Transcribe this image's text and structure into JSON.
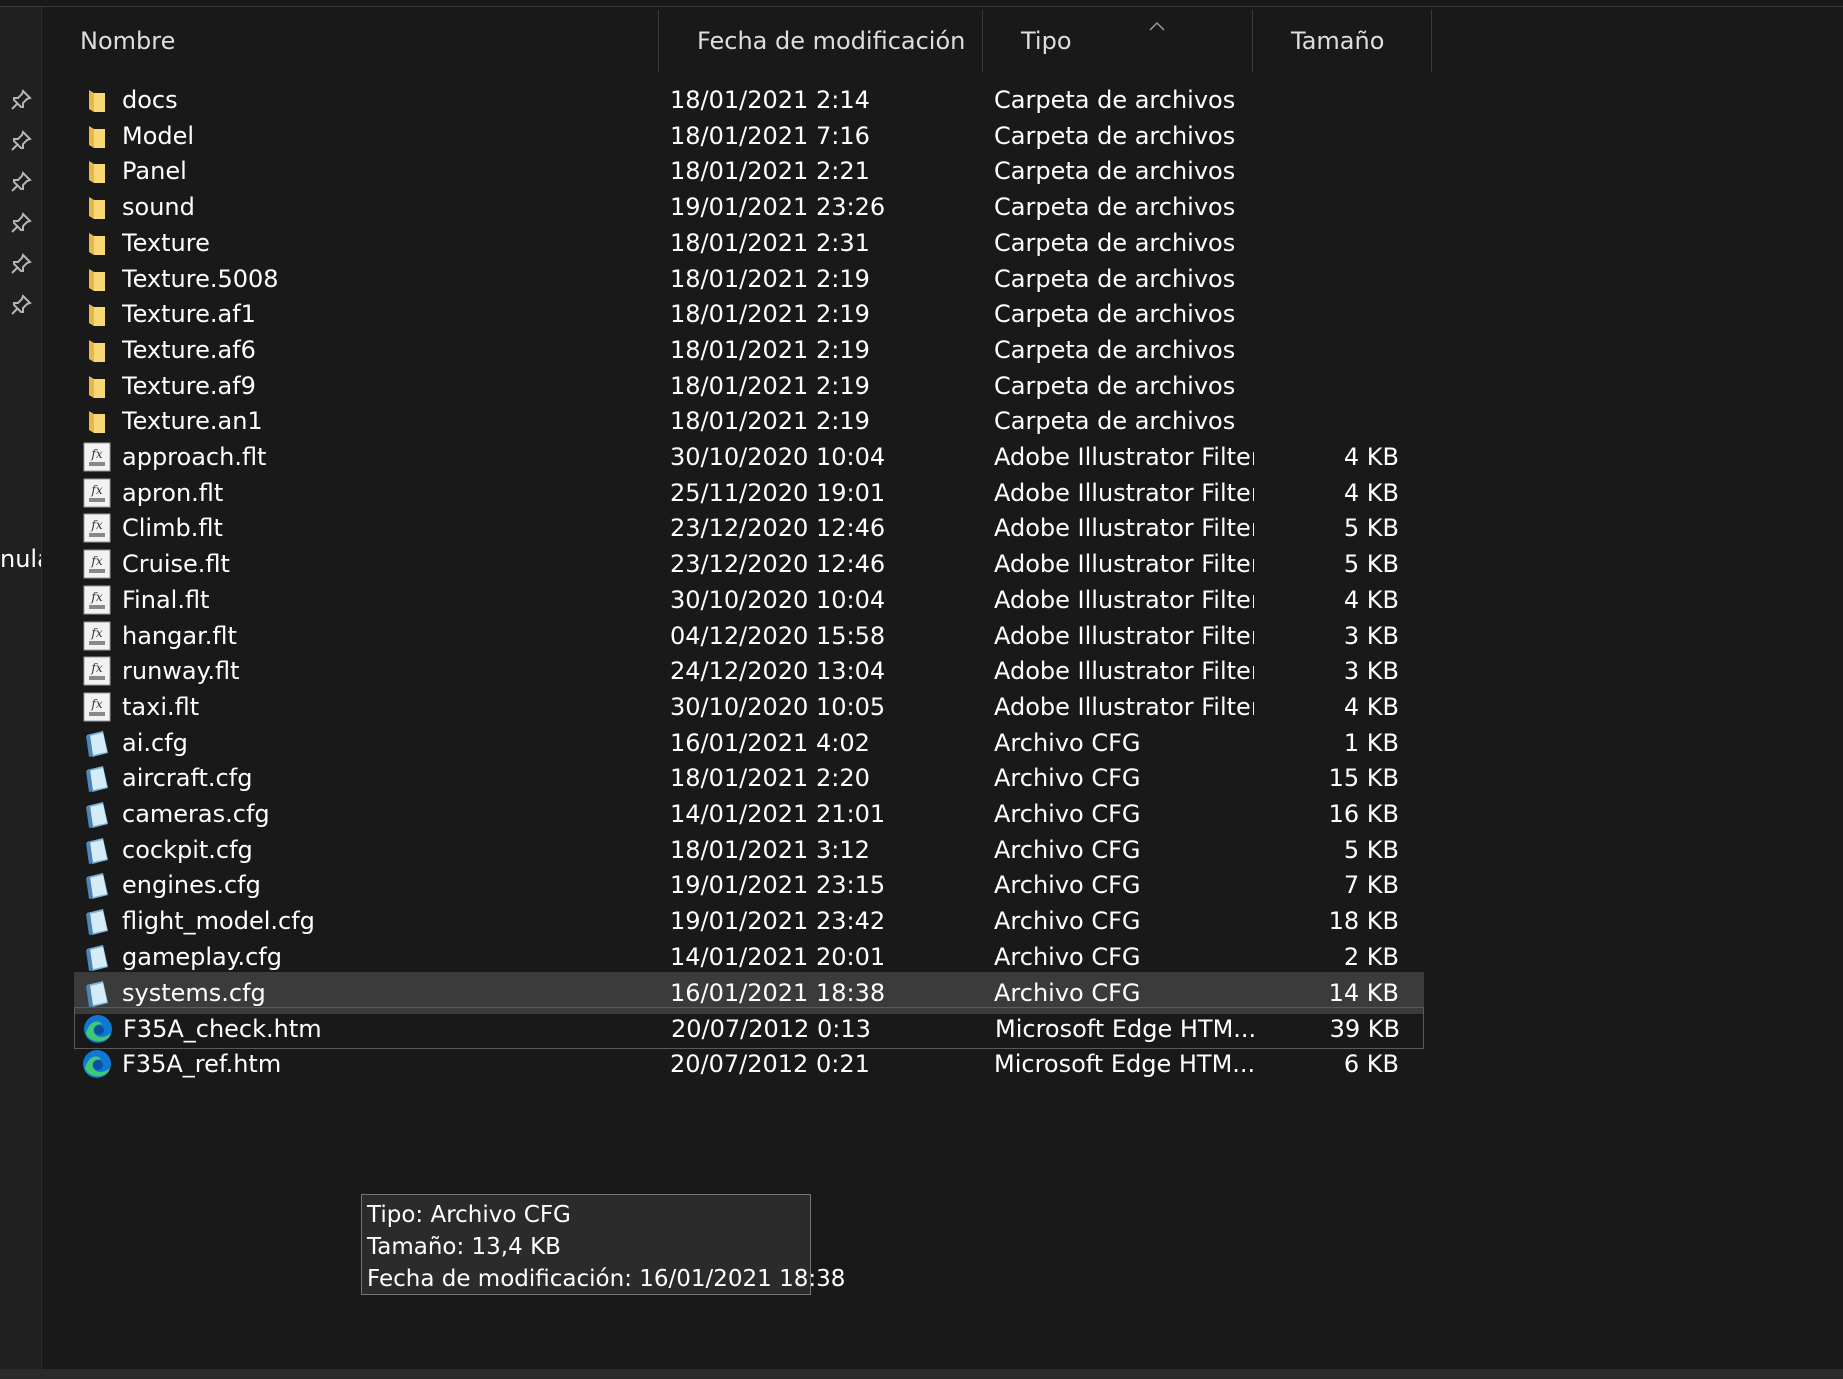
{
  "header": {
    "name": "Nombre",
    "date": "Fecha de modificación",
    "type": "Tipo",
    "size": "Tamaño"
  },
  "sidebar": {
    "truncated_text": "nula"
  },
  "files": [
    {
      "name": "docs",
      "date": "18/01/2021 2:14",
      "type": "Carpeta de archivos",
      "size": "",
      "icon": "folder-icon"
    },
    {
      "name": "Model",
      "date": "18/01/2021 7:16",
      "type": "Carpeta de archivos",
      "size": "",
      "icon": "folder-icon"
    },
    {
      "name": "Panel",
      "date": "18/01/2021 2:21",
      "type": "Carpeta de archivos",
      "size": "",
      "icon": "folder-icon"
    },
    {
      "name": "sound",
      "date": "19/01/2021 23:26",
      "type": "Carpeta de archivos",
      "size": "",
      "icon": "folder-icon"
    },
    {
      "name": "Texture",
      "date": "18/01/2021 2:31",
      "type": "Carpeta de archivos",
      "size": "",
      "icon": "folder-icon"
    },
    {
      "name": "Texture.5008",
      "date": "18/01/2021 2:19",
      "type": "Carpeta de archivos",
      "size": "",
      "icon": "folder-icon"
    },
    {
      "name": "Texture.af1",
      "date": "18/01/2021 2:19",
      "type": "Carpeta de archivos",
      "size": "",
      "icon": "folder-icon"
    },
    {
      "name": "Texture.af6",
      "date": "18/01/2021 2:19",
      "type": "Carpeta de archivos",
      "size": "",
      "icon": "folder-icon"
    },
    {
      "name": "Texture.af9",
      "date": "18/01/2021 2:19",
      "type": "Carpeta de archivos",
      "size": "",
      "icon": "folder-icon"
    },
    {
      "name": "Texture.an1",
      "date": "18/01/2021 2:19",
      "type": "Carpeta de archivos",
      "size": "",
      "icon": "folder-icon"
    },
    {
      "name": "approach.flt",
      "date": "30/10/2020 10:04",
      "type": "Adobe Illustrator Filter",
      "size": "4 KB",
      "icon": "filter-file-icon"
    },
    {
      "name": "apron.flt",
      "date": "25/11/2020 19:01",
      "type": "Adobe Illustrator Filter",
      "size": "4 KB",
      "icon": "filter-file-icon"
    },
    {
      "name": "Climb.flt",
      "date": "23/12/2020 12:46",
      "type": "Adobe Illustrator Filter",
      "size": "5 KB",
      "icon": "filter-file-icon"
    },
    {
      "name": "Cruise.flt",
      "date": "23/12/2020 12:46",
      "type": "Adobe Illustrator Filter",
      "size": "5 KB",
      "icon": "filter-file-icon"
    },
    {
      "name": "Final.flt",
      "date": "30/10/2020 10:04",
      "type": "Adobe Illustrator Filter",
      "size": "4 KB",
      "icon": "filter-file-icon"
    },
    {
      "name": "hangar.flt",
      "date": "04/12/2020 15:58",
      "type": "Adobe Illustrator Filter",
      "size": "3 KB",
      "icon": "filter-file-icon"
    },
    {
      "name": "runway.flt",
      "date": "24/12/2020 13:04",
      "type": "Adobe Illustrator Filter",
      "size": "3 KB",
      "icon": "filter-file-icon"
    },
    {
      "name": "taxi.flt",
      "date": "30/10/2020 10:05",
      "type": "Adobe Illustrator Filter",
      "size": "4 KB",
      "icon": "filter-file-icon"
    },
    {
      "name": "ai.cfg",
      "date": "16/01/2021 4:02",
      "type": "Archivo CFG",
      "size": "1 KB",
      "icon": "cfg-file-icon"
    },
    {
      "name": "aircraft.cfg",
      "date": "18/01/2021 2:20",
      "type": "Archivo CFG",
      "size": "15 KB",
      "icon": "cfg-file-icon"
    },
    {
      "name": "cameras.cfg",
      "date": "14/01/2021 21:01",
      "type": "Archivo CFG",
      "size": "16 KB",
      "icon": "cfg-file-icon"
    },
    {
      "name": "cockpit.cfg",
      "date": "18/01/2021 3:12",
      "type": "Archivo CFG",
      "size": "5 KB",
      "icon": "cfg-file-icon"
    },
    {
      "name": "engines.cfg",
      "date": "19/01/2021 23:15",
      "type": "Archivo CFG",
      "size": "7 KB",
      "icon": "cfg-file-icon"
    },
    {
      "name": "flight_model.cfg",
      "date": "19/01/2021 23:42",
      "type": "Archivo CFG",
      "size": "18 KB",
      "icon": "cfg-file-icon"
    },
    {
      "name": "gameplay.cfg",
      "date": "14/01/2021 20:01",
      "type": "Archivo CFG",
      "size": "2 KB",
      "icon": "cfg-file-icon"
    },
    {
      "name": "systems.cfg",
      "date": "16/01/2021 18:38",
      "type": "Archivo CFG",
      "size": "14 KB",
      "icon": "cfg-file-icon",
      "selected": true
    },
    {
      "name": "F35A_check.htm",
      "date": "20/07/2012 0:13",
      "type": "Microsoft Edge HTM...",
      "size": "39 KB",
      "icon": "edge-icon",
      "hover": true
    },
    {
      "name": "F35A_ref.htm",
      "date": "20/07/2012 0:21",
      "type": "Microsoft Edge HTM...",
      "size": "6 KB",
      "icon": "edge-icon"
    }
  ],
  "tooltip": {
    "type_line": "Tipo: Archivo CFG",
    "size_line": "Tamaño: 13,4 KB",
    "date_line": "Fecha de modificación: 16/01/2021 18:38"
  },
  "colors": {
    "background": "#191919",
    "selected_row": "#3b3b3b",
    "folder": "#f8d775",
    "edge_blue": "#0f78d4",
    "edge_green": "#41c876"
  }
}
